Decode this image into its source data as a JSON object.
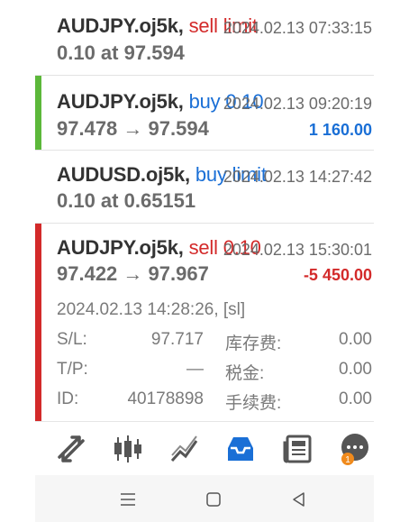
{
  "orders": [
    {
      "symbol": "AUDJPY.oj5k,",
      "action": "sell limit",
      "time": "2024.02.13 07:33:15",
      "line2": "0.10 at 97.594",
      "profit": "",
      "bar_color": "",
      "action_color": "#d32a2a"
    },
    {
      "symbol": "AUDJPY.oj5k,",
      "action": "buy 0.10",
      "time": "2024.02.13 09:20:19",
      "line2": "97.478 → 97.594",
      "profit": "1 160.00",
      "profit_color": "#1a6fd6",
      "bar_color": "#5cb83a",
      "action_color": "#1a6fd6"
    },
    {
      "symbol": "AUDUSD.oj5k,",
      "action": "buy limit",
      "time": "2024.02.13 14:27:42",
      "line2": "0.10 at 0.65151",
      "profit": "",
      "bar_color": "",
      "action_color": "#1a6fd6"
    },
    {
      "symbol": "AUDJPY.oj5k,",
      "action": "sell 0.10",
      "time": "2024.02.13 15:30:01",
      "line2": "97.422 → 97.967",
      "profit": "-5 450.00",
      "profit_color": "#d32a2a",
      "bar_color": "#d32a2a",
      "action_color": "#d32a2a"
    }
  ],
  "expanded": {
    "open_time": "2024.02.13 14:28:26, [sl]",
    "sl_label": "S/L:",
    "sl_value": "97.717",
    "tp_label": "T/P:",
    "tp_value": "—",
    "id_label": "ID:",
    "id_value": "40178898",
    "swap_label": "库存费:",
    "swap_value": "0.00",
    "tax_label": "税金:",
    "tax_value": "0.00",
    "fee_label": "手续费:",
    "fee_value": "0.00"
  },
  "toolbar": {
    "icons": [
      "trade-arrows-icon",
      "candlestick-chart-icon",
      "trend-chart-icon",
      "inbox-icon",
      "news-icon",
      "chat-bubble-icon"
    ],
    "chat_badge": "1",
    "active_color": "#1a6fd6"
  },
  "navbar": {
    "icons": [
      "menu-icon",
      "home-icon",
      "back-icon"
    ]
  }
}
